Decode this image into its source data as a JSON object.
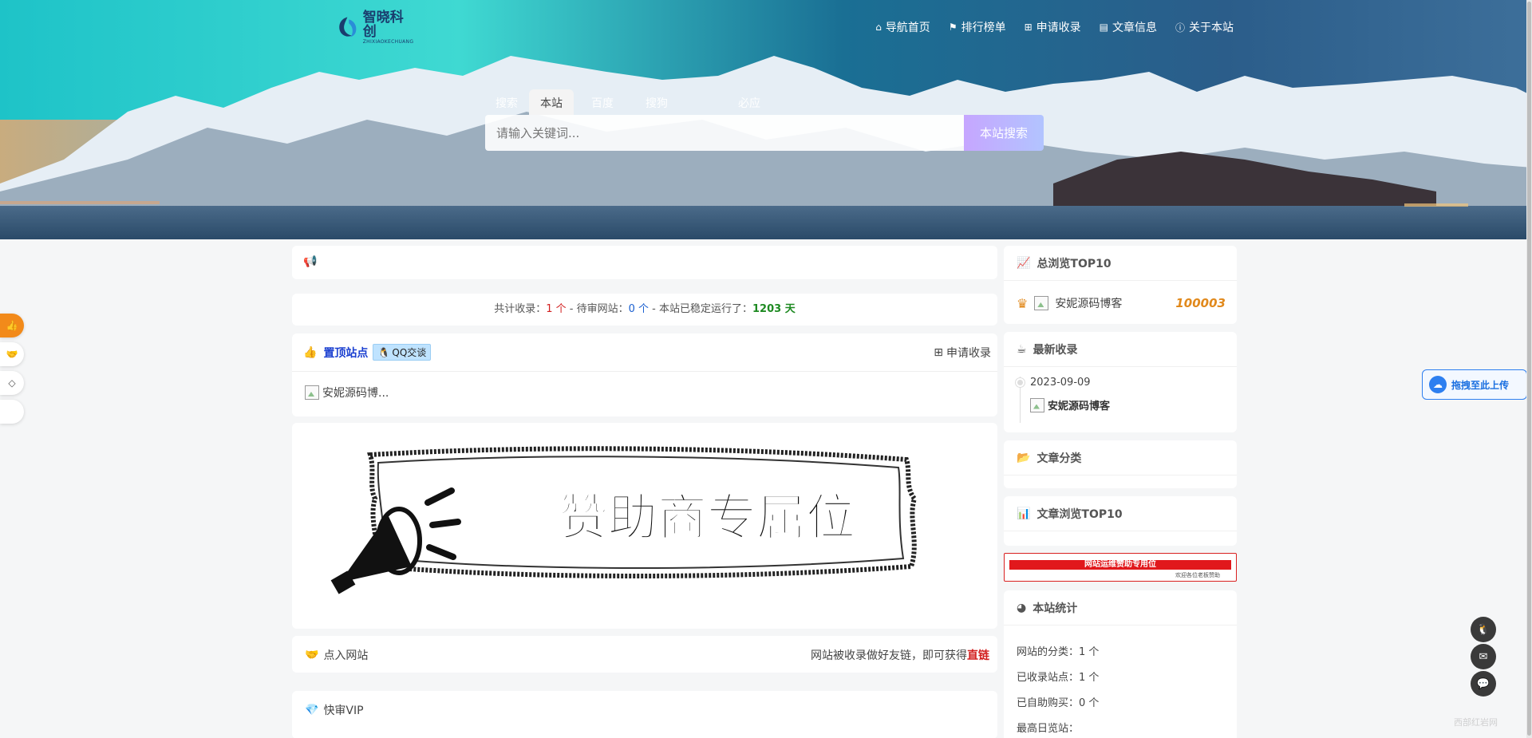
{
  "logo": {
    "name": "智晓科创",
    "sub": "ZHIXIAOKECHUANG"
  },
  "nav": [
    {
      "icon": "home-icon",
      "glyph": "⌂",
      "label": "导航首页"
    },
    {
      "icon": "flag-icon",
      "glyph": "⚑",
      "label": "排行榜单"
    },
    {
      "icon": "plus-square-icon",
      "glyph": "⊞",
      "label": "申请收录"
    },
    {
      "icon": "book-icon",
      "glyph": "▤",
      "label": "文章信息"
    },
    {
      "icon": "info-icon",
      "glyph": "ⓘ",
      "label": "关于本站"
    }
  ],
  "search": {
    "tabs": [
      "搜索",
      "本站",
      "百度",
      "搜狗",
      "必应"
    ],
    "active_tab": "本站",
    "placeholder": "请输入关键词...",
    "button": "本站搜索"
  },
  "stats_line": {
    "p1": "共计收录：",
    "total": "1 个",
    "p2": " - 待审网站：",
    "pending": "0 个",
    "p3": " - 本站已稳定运行了：",
    "days": "1203 天"
  },
  "pinned": {
    "title": "置顶站点",
    "qq_label": "QQ交谈",
    "apply": "申请收录",
    "item": "安妮源码博..."
  },
  "sponsor": {
    "text": "赞助商专属位"
  },
  "inlink": {
    "label": "点入网站",
    "right_text": "网站被收录做好友链，即可获得",
    "right_highlight": "直链"
  },
  "vip": {
    "label": "快审VIP"
  },
  "sidebar": {
    "top10": {
      "title": "总浏览TOP10",
      "site": "安妮源码博客",
      "count": "100003"
    },
    "newest": {
      "title": "最新收录",
      "date": "2023-09-09",
      "site": "安妮源码博客"
    },
    "category": {
      "title": "文章分类"
    },
    "viewtop": {
      "title": "文章浏览TOP10"
    },
    "banner": {
      "text": "网站运维赞助专用位",
      "sub": "欢迎各位老板赞助"
    },
    "stats": {
      "title": "本站统计",
      "rows": [
        {
          "label": "网站的分类：",
          "value": "1 个"
        },
        {
          "label": "已收录站点：",
          "value": "1 个"
        },
        {
          "label": "已自助购买：",
          "value": "0 个"
        },
        {
          "label": "最高日览站：",
          "value": ""
        }
      ]
    }
  },
  "upload_widget": {
    "label": "拖拽至此上传"
  },
  "watermark": "西部红岩网"
}
